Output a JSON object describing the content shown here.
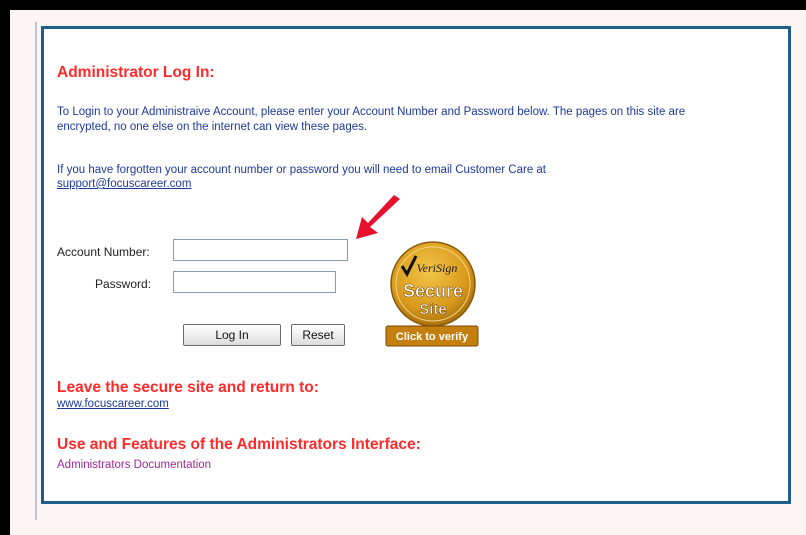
{
  "login": {
    "title": "Administrator Log In:",
    "intro": "To Login to your Administraive Account, please enter your Account Number and Password below. The pages on this site are encrypted, no one else on the internet can view these pages.",
    "forgot_text": "If you have forgotten your account number or password you will need to email Customer Care at",
    "support_email": "support@focuscareer.com",
    "account_label": "Account Number:",
    "account_value": "",
    "password_label": "Password:",
    "password_value": "",
    "login_button": "Log In",
    "reset_button": "Reset"
  },
  "seal": {
    "brand": "VeriSign",
    "line1": "Secure",
    "line2": "Site",
    "cta": "Click to verify"
  },
  "leave": {
    "title": "Leave the secure site and return to:",
    "link": "www.focuscareer.com"
  },
  "features": {
    "title": "Use and Features of the Administrators Interface:",
    "link": "Administrators Documentation"
  },
  "colors": {
    "heading": "#ff2a2a",
    "body_text": "#1e3a9a",
    "panel_border": "#1f5f8c",
    "doc_link": "#a0289a",
    "seal_gold": "#d99a1c",
    "arrow": "#e8112d"
  }
}
